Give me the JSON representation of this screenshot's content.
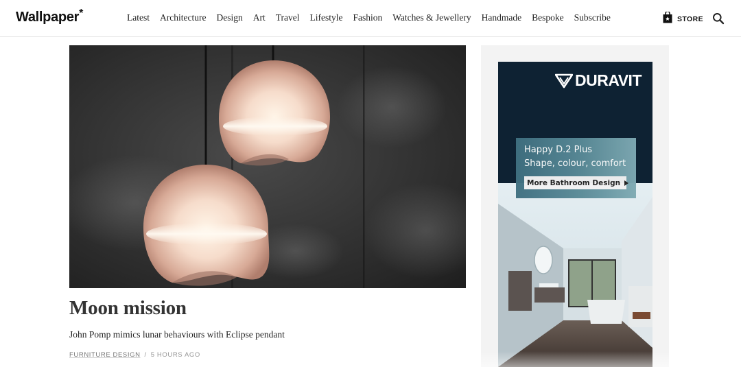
{
  "header": {
    "logo": "Wallpaper",
    "logo_mark": "*",
    "nav": [
      "Latest",
      "Architecture",
      "Design",
      "Art",
      "Travel",
      "Lifestyle",
      "Fashion",
      "Watches & Jewellery",
      "Handmade",
      "Bespoke",
      "Subscribe"
    ],
    "store_label": "STORE",
    "icons": {
      "store": "shopping-bag-icon",
      "search": "search-icon"
    }
  },
  "article": {
    "hero_image": "pendant-lamps-photo",
    "title": "Moon mission",
    "standfirst": "John Pomp mimics lunar behaviours with Eclipse pendant",
    "category": "FURNITURE DESIGN",
    "separator": "/",
    "time": "5 HOURS AGO"
  },
  "ad": {
    "brand": "DURAVIT",
    "headline_1": "Happy D.2 Plus",
    "headline_2": "Shape, colour, comfort",
    "cta": "More Bathroom Design",
    "colors": {
      "navy": "#0e2233",
      "teal": "#4d7f8e"
    }
  }
}
